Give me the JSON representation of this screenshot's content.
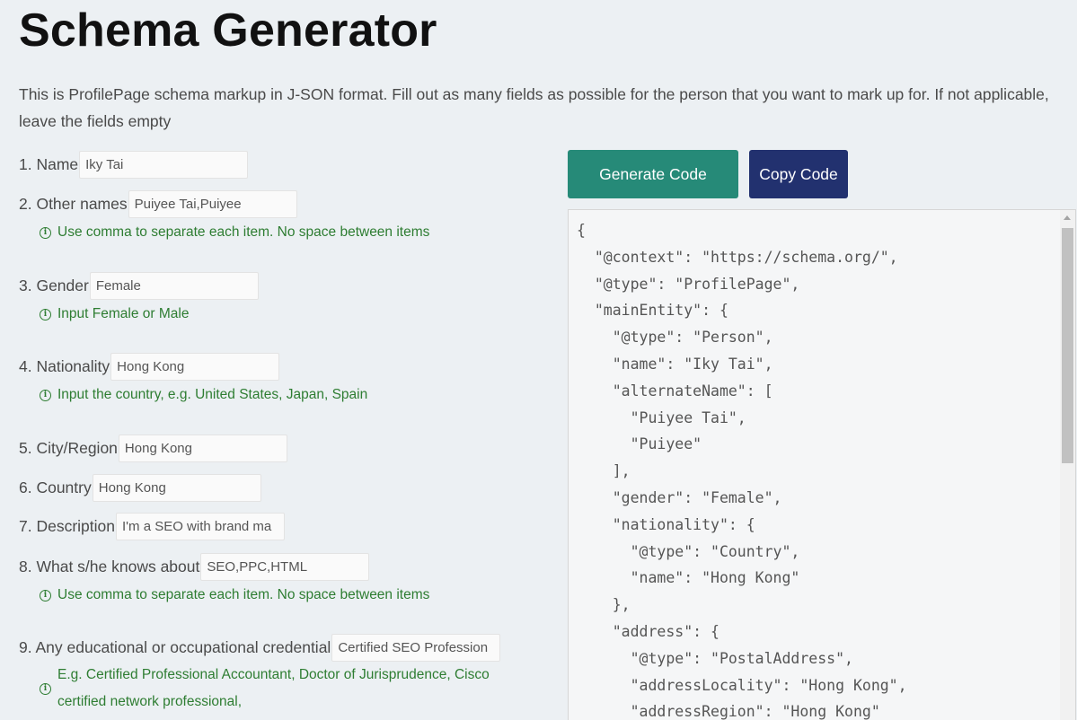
{
  "page_title": "Schema Generator",
  "intro": "This is ProfilePage schema markup in J-SON format. Fill out as many fields as possible for the person that you want to mark up for. If not applicable, leave the fields empty",
  "fields": [
    {
      "label": "1. Name",
      "value": "Iky Tai"
    },
    {
      "label": "2. Other names",
      "value": "Puiyee Tai,Puiyee"
    },
    {
      "label": "3. Gender",
      "value": "Female"
    },
    {
      "label": "4. Nationality",
      "value": "Hong Kong"
    },
    {
      "label": "5. City/Region",
      "value": "Hong Kong"
    },
    {
      "label": "6. Country",
      "value": "Hong Kong"
    },
    {
      "label": "7. Description",
      "value": "I'm a SEO with brand ma"
    },
    {
      "label": "8. What s/he knows about",
      "value": "SEO,PPC,HTML"
    },
    {
      "label": "9. Any educational or occupational credential",
      "value": "Certified SEO Profession"
    }
  ],
  "hints": {
    "other_names": "Use comma to separate each item. No space between items",
    "gender": "Input Female or Male",
    "nationality": "Input the country, e.g. United States, Japan, Spain",
    "knows_about": "Use comma to separate each item. No space between items",
    "credential": "E.g. Certified Professional Accountant, Doctor of Jurisprudence, Cisco certified network professional,"
  },
  "buttons": {
    "generate": "Generate Code",
    "copy": "Copy Code"
  },
  "code_lines": [
    "{",
    "  \"@context\": \"https://schema.org/\",",
    "  \"@type\": \"ProfilePage\",",
    "  \"mainEntity\": {",
    "    \"@type\": \"Person\",",
    "    \"name\": \"Iky Tai\",",
    "    \"alternateName\": [",
    "      \"Puiyee Tai\",",
    "      \"Puiyee\"",
    "    ],",
    "    \"gender\": \"Female\",",
    "    \"nationality\": {",
    "      \"@type\": \"Country\",",
    "      \"name\": \"Hong Kong\"",
    "    },",
    "    \"address\": {",
    "      \"@type\": \"PostalAddress\",",
    "      \"addressLocality\": \"Hong Kong\",",
    "      \"addressRegion\": \"Hong Kong\""
  ],
  "colors": {
    "generate_button": "#268a78",
    "copy_button": "#22316f",
    "hint_text": "#2e7d32",
    "background": "#ecf0f3"
  }
}
